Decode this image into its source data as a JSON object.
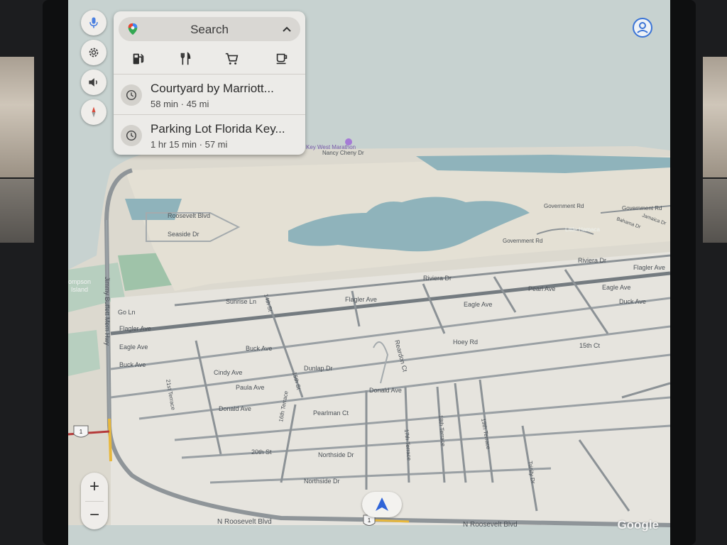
{
  "search": {
    "label": "Search"
  },
  "categories": [
    {
      "icon": "gas-station-icon"
    },
    {
      "icon": "restaurant-icon"
    },
    {
      "icon": "shopping-cart-icon"
    },
    {
      "icon": "coffee-icon"
    }
  ],
  "recents": [
    {
      "name": "Courtyard by Marriott...",
      "meta": "58 min · 45 mi"
    },
    {
      "name": "Parking Lot Florida Key...",
      "meta": "1 hr 15 min · 57 mi"
    }
  ],
  "side_buttons": [
    "microphone-icon",
    "gear-icon",
    "volume-icon",
    "compass-icon"
  ],
  "zoom": {
    "plus": "+",
    "minus": "−"
  },
  "map_labels": {
    "jimmy_buffett": "Jimmy Buffett Mem Hwy",
    "roosevelt_top": "Roosevelt Blvd",
    "seaside": "Seaside Dr",
    "thompson": "ompson",
    "island": "Island",
    "go_ln": "Go Ln",
    "flagler_left": "Flagler Ave",
    "eagle_left": "Eagle Ave",
    "buck_left": "Buck Ave",
    "sunrise": "Sunrise Ln",
    "flagler_mid": "Flagler Ave",
    "riviera_mid": "Riviera Dr",
    "eagle_mid": "Eagle Ave",
    "buck_mid": "Buck Ave",
    "cindy": "Cindy Ave",
    "paula": "Paula Ave",
    "donald_left": "Donald Ave",
    "donald_mid": "Donald Ave",
    "dunlap": "Dunlap Dr",
    "hoey": "Hoey Rd",
    "reardon": "Reardon Ct",
    "pearlman": "Pearlman Ct",
    "northside_mid": "Northside Dr",
    "northside_low": "Northside Dr",
    "twentieth": "20th St",
    "fifteenth": "15th Ct",
    "pearl": "Pearl Ave",
    "eagle_right": "Eagle Ave",
    "duck": "Duck Ave",
    "flagler_right": "Flagler Ave",
    "riviera_right": "Riviera Dr",
    "government1": "Government Rd",
    "government2": "Government Rd",
    "government3": "Government Rd",
    "little_hamaca": "Little Hamaca",
    "bahama": "Bahama Dr",
    "jamaica": "Jamaica Dr",
    "nancy": "Nancy Cheny Dr",
    "marathon_poi": "Key West Marathon",
    "roosevelt_bottom_left": "N Roosevelt Blvd",
    "roosevelt_bottom_right": "N Roosevelt Blvd",
    "trinity": "Trinity Dr",
    "seventeenth": "17th Terrace",
    "eighteenth": "18th Terrace",
    "nineteenth": "19th Terrace",
    "sixteenth": "16th Terrace",
    "twentyfirst": "21st Terrace",
    "fourteenth": "14th St",
    "fifteenth_st": "15th St",
    "route1": "1"
  },
  "attribution": "Google"
}
